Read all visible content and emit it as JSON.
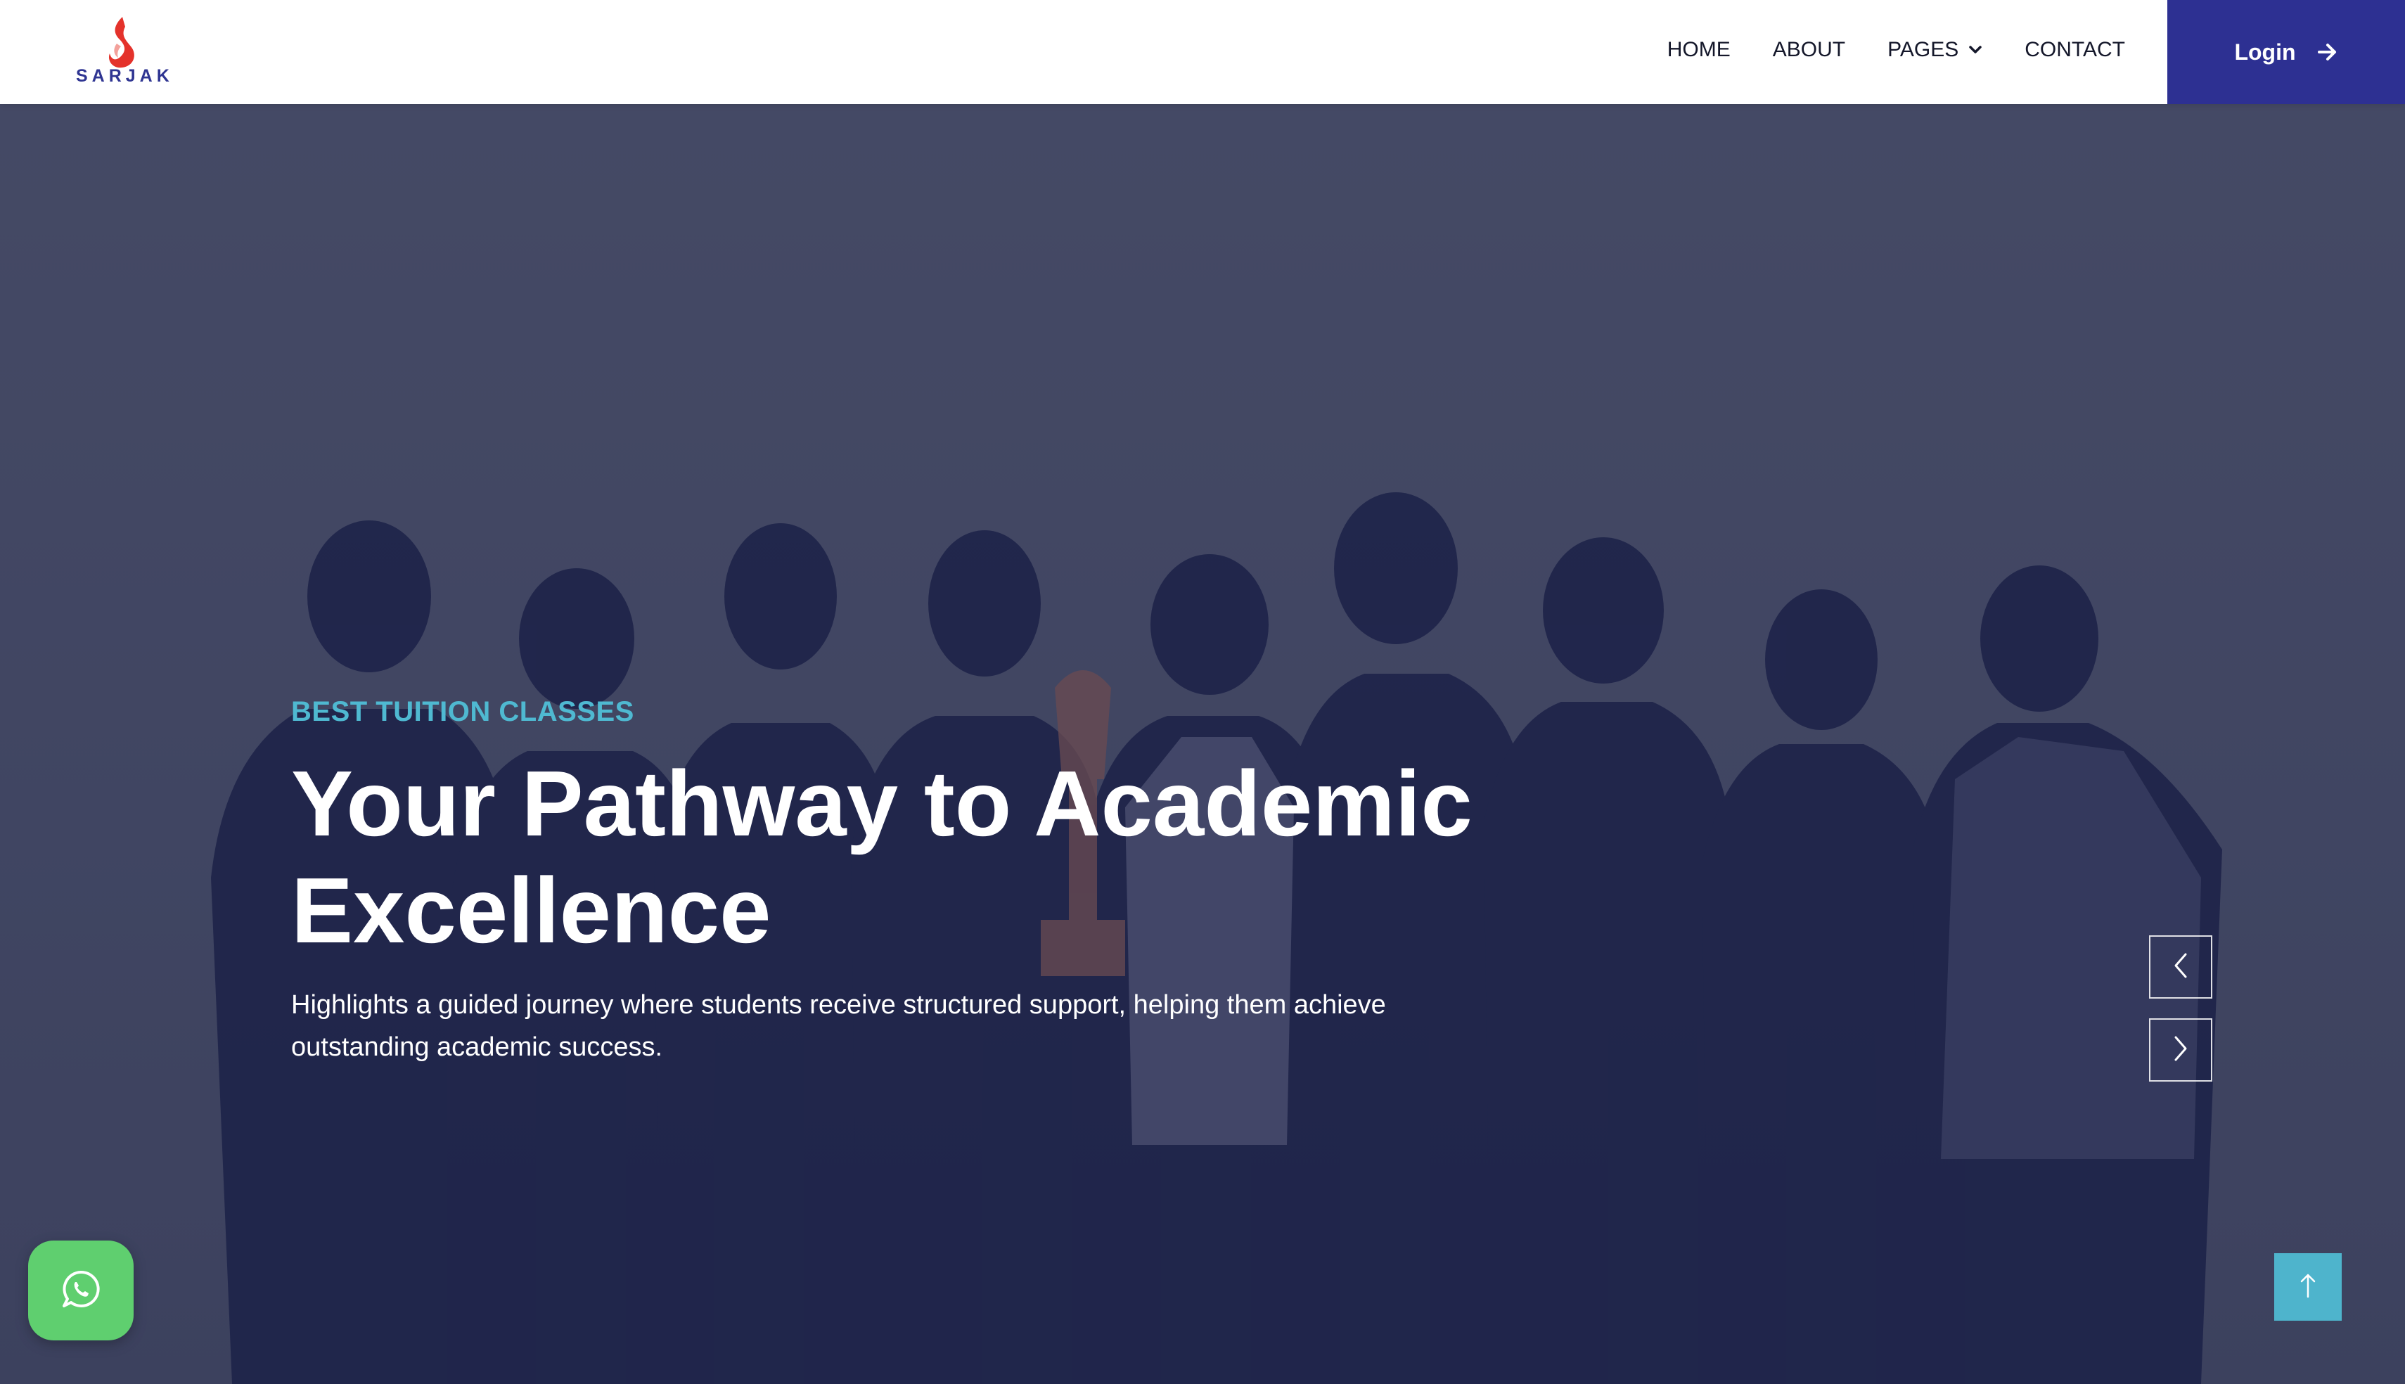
{
  "brand": {
    "name": "SARJAK",
    "accent": "#2d3092",
    "flame_colors": [
      "#e4322b",
      "#f07a73"
    ]
  },
  "nav": {
    "items": [
      {
        "label": "HOME"
      },
      {
        "label": "ABOUT"
      },
      {
        "label": "PAGES",
        "has_dropdown": true,
        "icon": "chevron-down-icon"
      },
      {
        "label": "CONTACT"
      }
    ],
    "login": {
      "label": "Login",
      "icon": "arrow-right-icon"
    }
  },
  "hero": {
    "tagline": "BEST TUITION CLASSES",
    "headline_line1": "Your Pathway to Academic",
    "headline_line2": "Excellence",
    "subtext": "Highlights a guided journey where students receive structured support, helping them achieve outstanding academic success.",
    "tagline_color": "#4fb9d1"
  },
  "carousel": {
    "prev_icon": "chevron-left-icon",
    "next_icon": "chevron-right-icon"
  },
  "floating": {
    "whatsapp_icon": "whatsapp-icon",
    "whatsapp_color": "#5fcf6f",
    "scroll_top_icon": "arrow-up-icon",
    "scroll_top_color": "#4eb4cc"
  }
}
